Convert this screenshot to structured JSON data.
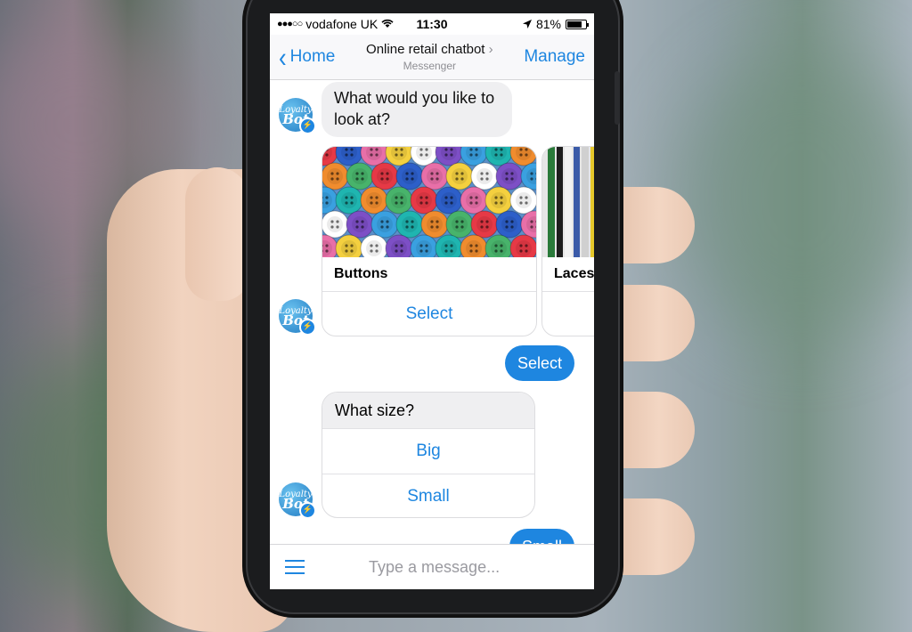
{
  "status_bar": {
    "signal_dots": "●●●○○",
    "carrier": "vodafone UK",
    "time": "11:30",
    "battery": "81%",
    "battery_level": 0.81
  },
  "nav": {
    "back_label": "Home",
    "title": "Online retail chatbot",
    "title_chevron": "›",
    "subtitle": "Messenger",
    "manage_label": "Manage"
  },
  "bot_avatar": {
    "line1": "Loyalty",
    "line2": "Bot",
    "badge_icon": "messenger-icon"
  },
  "messages": {
    "prompt1": "What would you like to look at?",
    "carousel": [
      {
        "title": "Buttons",
        "action": "Select"
      },
      {
        "title": "Laces",
        "action": ""
      }
    ],
    "user_reply1": "Select",
    "question": "What size?",
    "size_options": [
      "Big",
      "Small"
    ],
    "user_reply2": "Small"
  },
  "composer": {
    "placeholder": "Type a message...",
    "menu_icon": "hamburger-menu-icon"
  },
  "colors": {
    "accent": "#1e86e0",
    "incoming_bubble": "#efeff1"
  }
}
